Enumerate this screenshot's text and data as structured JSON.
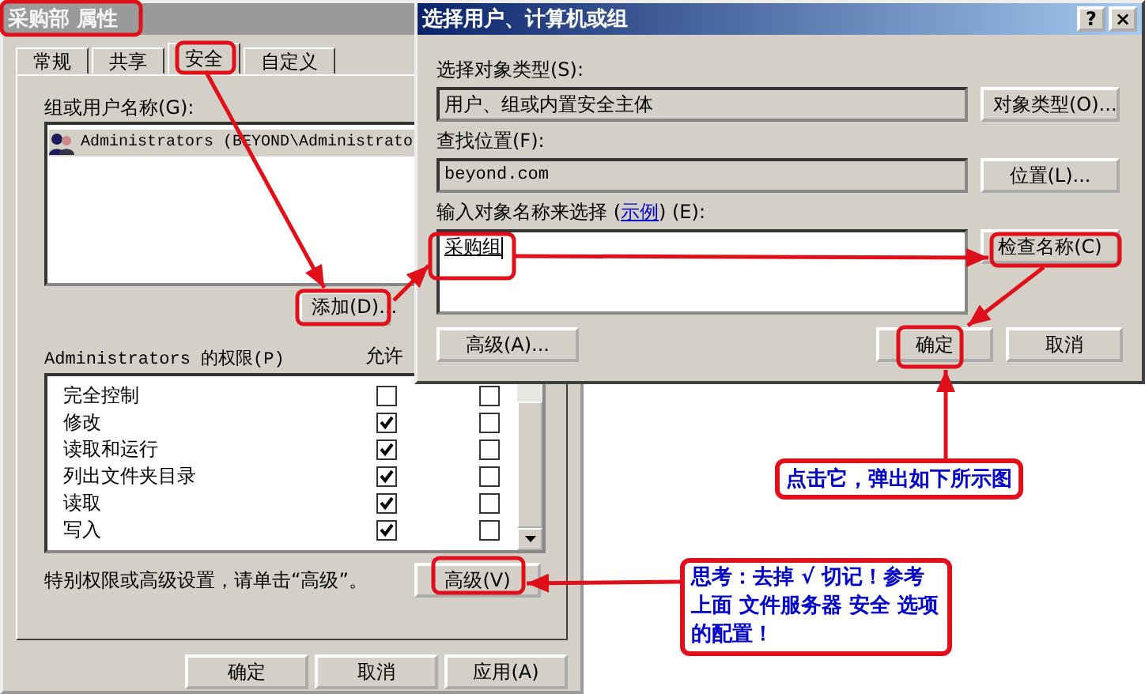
{
  "properties_window": {
    "title": "采购部 属性",
    "tabs": [
      {
        "label": "常规",
        "selected": false
      },
      {
        "label": "共享",
        "selected": false
      },
      {
        "label": "安全",
        "selected": true
      },
      {
        "label": "自定义",
        "selected": false
      }
    ],
    "group_label": "组或用户名称(G):",
    "groups": [
      {
        "name": "Administrators (BEYOND\\Administrato",
        "selected": true
      }
    ],
    "add_button": "添加(D)...",
    "permissions_label": "Administrators 的权限(P)",
    "allow_header": "允许",
    "permissions": [
      {
        "name": "完全控制",
        "allow": false,
        "deny": false
      },
      {
        "name": "修改",
        "allow": true,
        "deny": false
      },
      {
        "name": "读取和运行",
        "allow": true,
        "deny": false
      },
      {
        "name": "列出文件夹目录",
        "allow": true,
        "deny": false
      },
      {
        "name": "读取",
        "allow": true,
        "deny": false
      },
      {
        "name": "写入",
        "allow": true,
        "deny": false
      }
    ],
    "advanced_hint": "特别权限或高级设置，请单击“高级”。",
    "advanced_button": "高级(V)",
    "buttons": [
      "确定",
      "取消",
      "应用(A)"
    ]
  },
  "select_dialog": {
    "title": "选择用户、计算机或组",
    "help_button": "?",
    "close_button": "×",
    "object_type_label": "选择对象类型(S):",
    "object_type": "用户、组或内置安全主体",
    "object_type_button": "对象类型(O)...",
    "location_label": "查找位置(F):",
    "location": "beyond.com",
    "location_button": "位置(L)...",
    "names_label_before": "输入对象名称来选择 (",
    "names_label_link": "示例",
    "names_label_after": ") (E):",
    "names_value": "采购组",
    "check_names_button": "检查名称(C)",
    "advanced_button": "高级(A)...",
    "ok_button": "确定",
    "cancel_button": "取消"
  },
  "callouts": [
    "点击它，弹出如下所示图",
    "思考：去掉 √ 切记！参考上面 文件服务器 安全 选项的配置！"
  ]
}
